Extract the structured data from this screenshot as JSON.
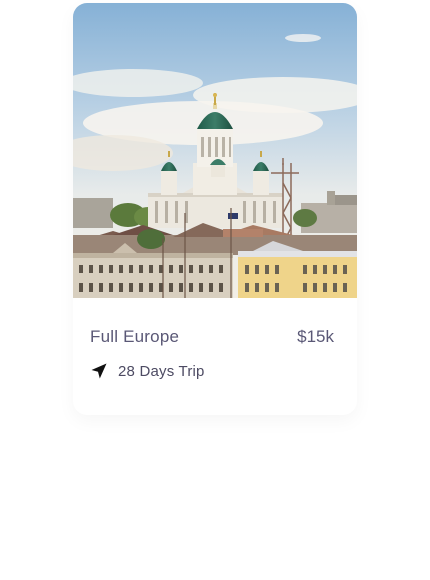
{
  "card": {
    "title": "Full Europe",
    "price": "$15k",
    "duration": "28 Days Trip",
    "image_subject": "cathedral-cityscape-photo",
    "location_icon": "navigation-arrow-icon"
  },
  "colors": {
    "title_text": "#5a5876",
    "meta_text": "#4d4b63",
    "sky_top": "#8fb6d8",
    "dome_green": "#2f6b57"
  }
}
